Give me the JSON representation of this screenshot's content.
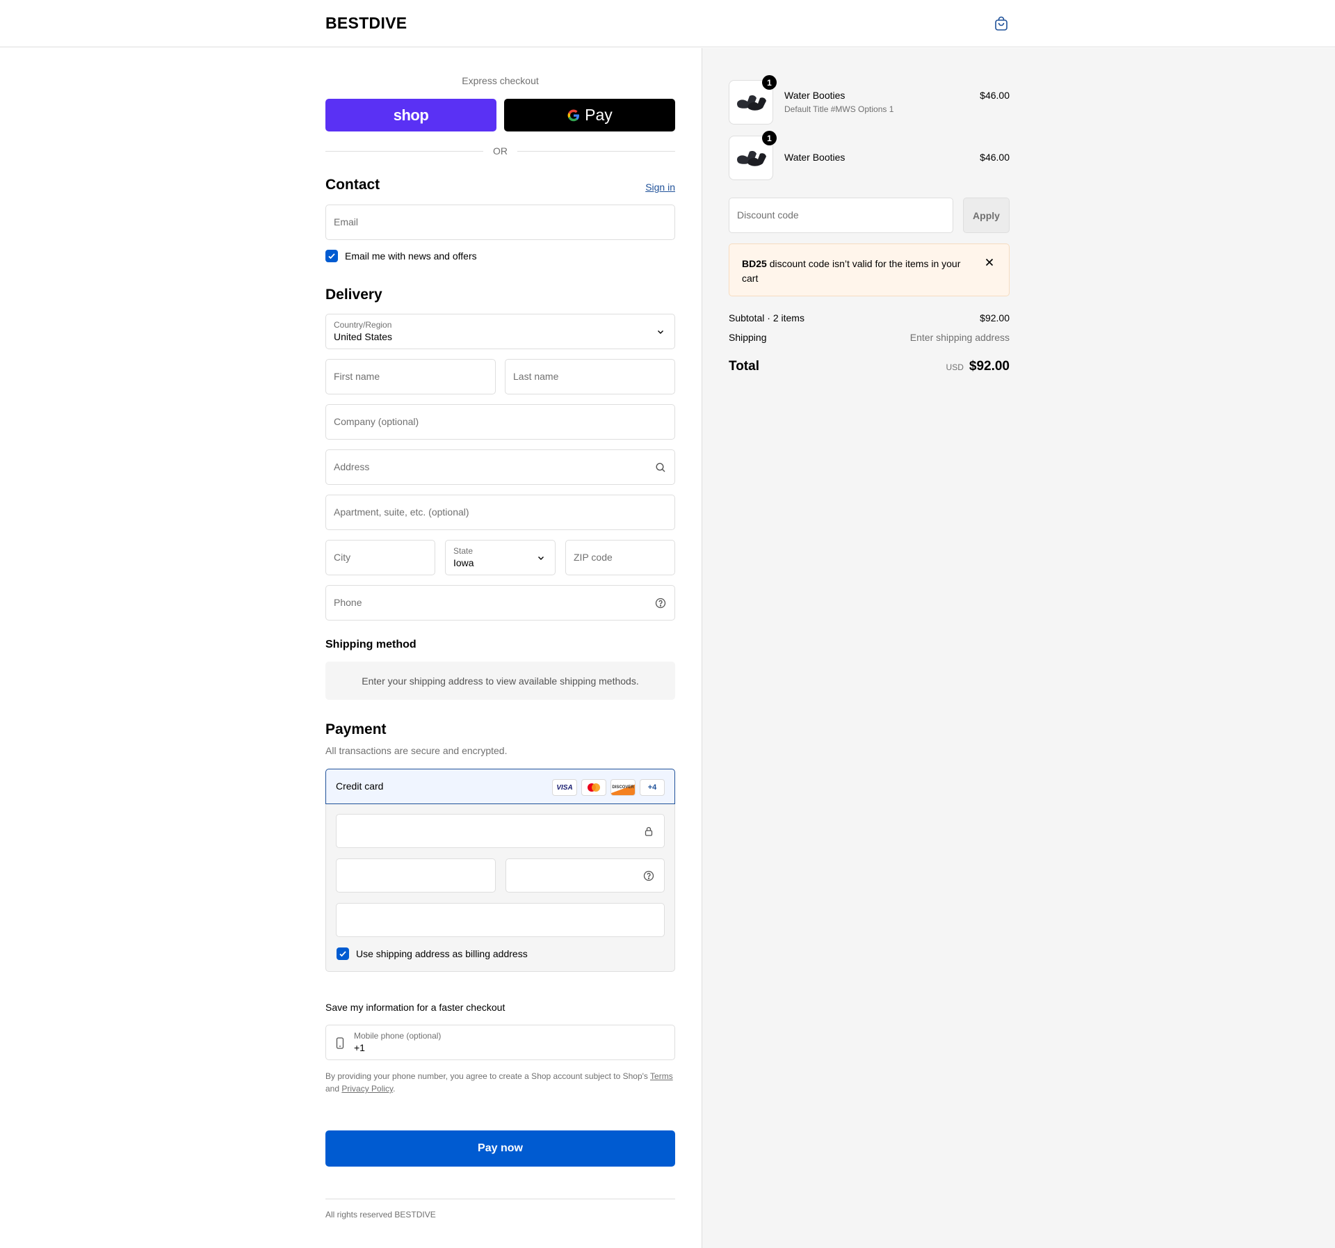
{
  "header": {
    "store_name": "BESTDIVE",
    "cart_icon": "shopping-bag-icon"
  },
  "express": {
    "label": "Express checkout",
    "shop_label": "shop",
    "gpay_label": "Pay",
    "or_label": "OR"
  },
  "contact": {
    "title": "Contact",
    "sign_in": "Sign in",
    "email_placeholder": "Email",
    "newsletter_label": "Email me with news and offers",
    "newsletter_checked": true
  },
  "delivery": {
    "title": "Delivery",
    "country_label": "Country/Region",
    "country_value": "United States",
    "first_name_placeholder": "First name",
    "last_name_placeholder": "Last name",
    "company_placeholder": "Company (optional)",
    "address_placeholder": "Address",
    "apartment_placeholder": "Apartment, suite, etc. (optional)",
    "city_placeholder": "City",
    "state_label": "State",
    "state_value": "Iowa",
    "zip_placeholder": "ZIP code",
    "phone_placeholder": "Phone"
  },
  "shipping_method": {
    "title": "Shipping method",
    "notice": "Enter your shipping address to view available shipping methods."
  },
  "payment": {
    "title": "Payment",
    "subtitle": "All transactions are secure and encrypted.",
    "method_label": "Credit card",
    "card_badges": [
      "VISA",
      "MC",
      "DISCOVER",
      "+4"
    ],
    "billing_same_label": "Use shipping address as billing address",
    "billing_same_checked": true
  },
  "save_info": {
    "title": "Save my information for a faster checkout",
    "mobile_label": "Mobile phone (optional)",
    "mobile_value": "+1",
    "legal_prefix": "By providing your phone number, you agree to create a Shop account subject to Shop's",
    "terms": "Terms",
    "and": "and",
    "privacy": "Privacy Policy",
    "period": "."
  },
  "pay_button": "Pay now",
  "footer": "All rights reserved BESTDIVE",
  "cart": {
    "items": [
      {
        "name": "Water Booties",
        "variant": "Default Title #MWS Options 1",
        "price": "$46.00",
        "qty": "1"
      },
      {
        "name": "Water Booties",
        "variant": "",
        "price": "$46.00",
        "qty": "1"
      }
    ],
    "discount_placeholder": "Discount code",
    "apply_label": "Apply",
    "alert_code": "BD25",
    "alert_text": "discount code isn’t valid for the items in your cart",
    "subtotal_label": "Subtotal · 2 items",
    "subtotal_value": "$92.00",
    "shipping_label": "Shipping",
    "shipping_value": "Enter shipping address",
    "total_label": "Total",
    "currency": "USD",
    "total_value": "$92.00"
  },
  "colors": {
    "shop_purple": "#5a31f4",
    "primary_blue": "#005bd1",
    "link_blue": "#1f5199",
    "alert_bg": "#fff5eb"
  }
}
